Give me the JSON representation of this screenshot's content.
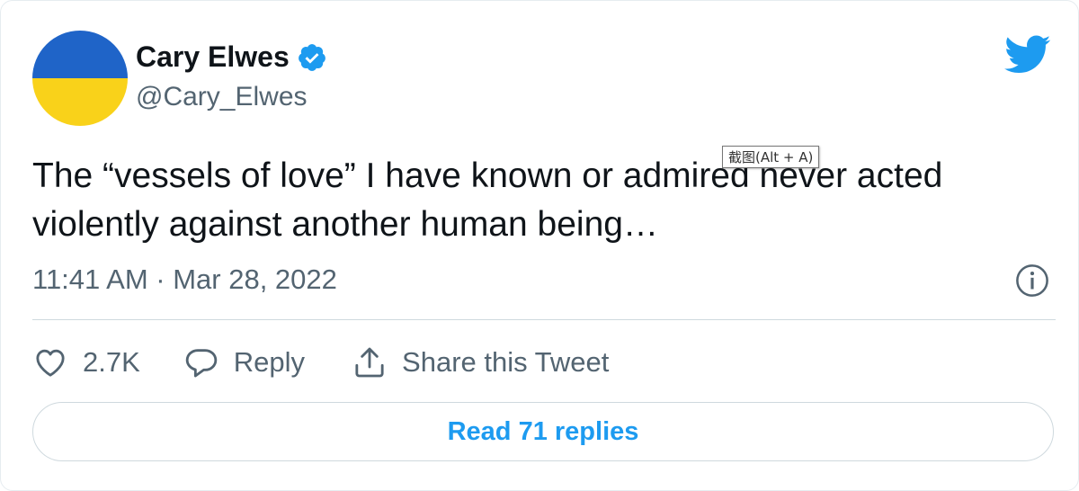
{
  "author": {
    "name": "Cary Elwes",
    "handle": "@Cary_Elwes",
    "avatar_colors": {
      "top": "#1f64c8",
      "bottom": "#f9d21a"
    }
  },
  "tweet": {
    "text_line1": "The “vessels of love” I have known or admired never acted",
    "text_line2": "violently against another human being…",
    "timestamp": "11:41 AM · Mar 28, 2022"
  },
  "tooltip": {
    "text": "截图(Alt + A)"
  },
  "actions": {
    "like_count": "2.7K",
    "reply_label": "Reply",
    "share_label": "Share this Tweet"
  },
  "read_replies": {
    "label": "Read 71 replies"
  },
  "colors": {
    "accent": "#1d9bf0",
    "muted": "#536471",
    "text": "#0f1419"
  },
  "icons": [
    "twitter-bird-icon",
    "verified-badge-icon",
    "info-icon",
    "heart-icon",
    "reply-bubble-icon",
    "share-icon"
  ]
}
